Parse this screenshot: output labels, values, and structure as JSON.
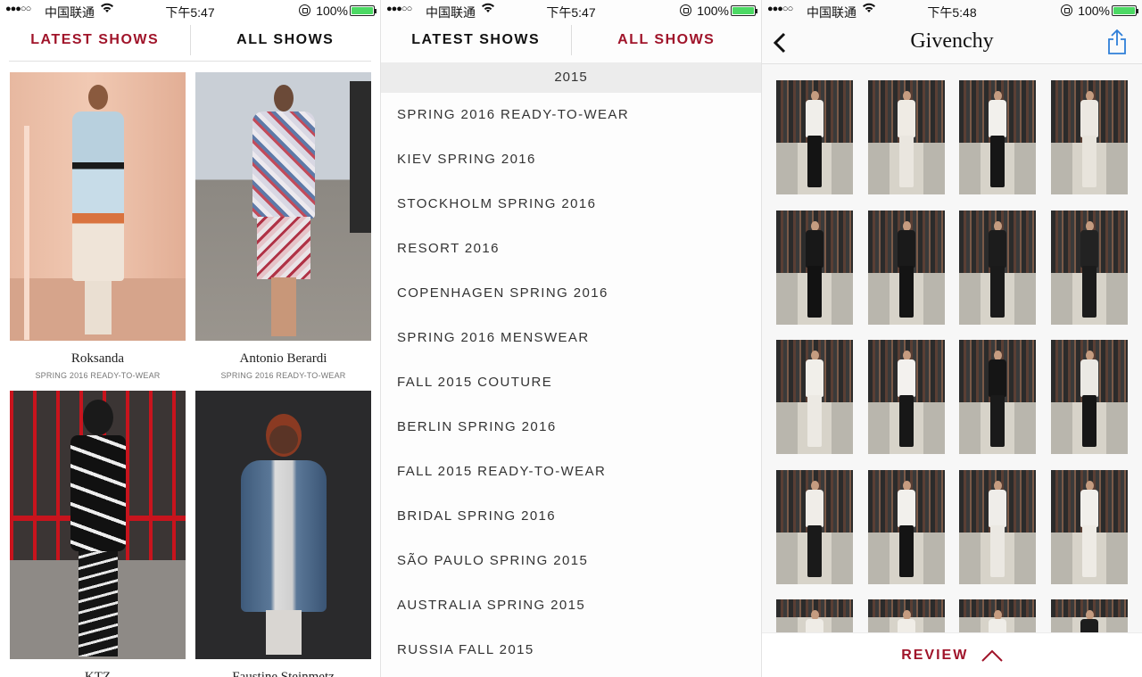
{
  "status_bars": [
    {
      "signal": "●●●○○",
      "carrier": "中国联通",
      "time": "下午5:47",
      "battery": "100%"
    },
    {
      "signal": "●●●○○",
      "carrier": "中国联通",
      "time": "下午5:47",
      "battery": "100%"
    },
    {
      "signal": "●●●○○",
      "carrier": "中国联通",
      "time": "下午5:48",
      "battery": "100%"
    }
  ],
  "latest_screen": {
    "tabs": {
      "latest": "LATEST SHOWS",
      "all": "ALL SHOWS",
      "active": "latest"
    },
    "shows": [
      {
        "designer": "Roksanda",
        "season": "SPRING 2016 READY-TO-WEAR"
      },
      {
        "designer": "Antonio Berardi",
        "season": "SPRING 2016 READY-TO-WEAR"
      },
      {
        "designer": "KTZ",
        "season": ""
      },
      {
        "designer": "Faustine Steinmetz",
        "season": ""
      }
    ]
  },
  "all_shows_screen": {
    "tabs": {
      "latest": "LATEST SHOWS",
      "all": "ALL SHOWS",
      "active": "all"
    },
    "year": "2015",
    "items": [
      "SPRING 2016 READY-TO-WEAR",
      "KIEV SPRING 2016",
      "STOCKHOLM SPRING 2016",
      "RESORT 2016",
      "COPENHAGEN SPRING 2016",
      "SPRING 2016 MENSWEAR",
      "FALL 2015 COUTURE",
      "BERLIN SPRING 2016",
      "FALL 2015 READY-TO-WEAR",
      "BRIDAL SPRING 2016",
      "SÃO PAULO SPRING 2015",
      "AUSTRALIA SPRING 2015",
      "RUSSIA FALL 2015"
    ]
  },
  "designer_screen": {
    "title": "Givenchy",
    "review_label": "REVIEW",
    "looks": [
      {
        "top": "#f0eeea",
        "bottom": "#141414"
      },
      {
        "top": "#efebe4",
        "bottom": "#eae6df"
      },
      {
        "top": "#f2f0ec",
        "bottom": "#161616"
      },
      {
        "top": "#ece8e2",
        "bottom": "#e8e4dc"
      },
      {
        "top": "#181818",
        "bottom": "#121212"
      },
      {
        "top": "#1a1a1a",
        "bottom": "#141414"
      },
      {
        "top": "#1c1c1c",
        "bottom": "#1a1a1a"
      },
      {
        "top": "#222222",
        "bottom": "#1b1b1b"
      },
      {
        "top": "#f1efea",
        "bottom": "#ece9e3"
      },
      {
        "top": "#f3f1ee",
        "bottom": "#171717"
      },
      {
        "top": "#151515",
        "bottom": "#1a1a1a"
      },
      {
        "top": "#ebe9e4",
        "bottom": "#161616"
      },
      {
        "top": "#f0ede8",
        "bottom": "#1a1a1a"
      },
      {
        "top": "#f2f0ec",
        "bottom": "#141414"
      },
      {
        "top": "#efede9",
        "bottom": "#ebe8e2"
      },
      {
        "top": "#f1efeb",
        "bottom": "#eeebe5"
      },
      {
        "top": "#efece6",
        "bottom": "#d9d5ce"
      },
      {
        "top": "#f0ede7",
        "bottom": "#d8d4cc"
      },
      {
        "top": "#efede8",
        "bottom": "#d6d2ca"
      },
      {
        "top": "#1d1d1d",
        "bottom": "#d8d4cc"
      }
    ]
  },
  "colors": {
    "accent": "#a0142a",
    "battery": "#4cd964",
    "share": "#2f7fd8"
  }
}
